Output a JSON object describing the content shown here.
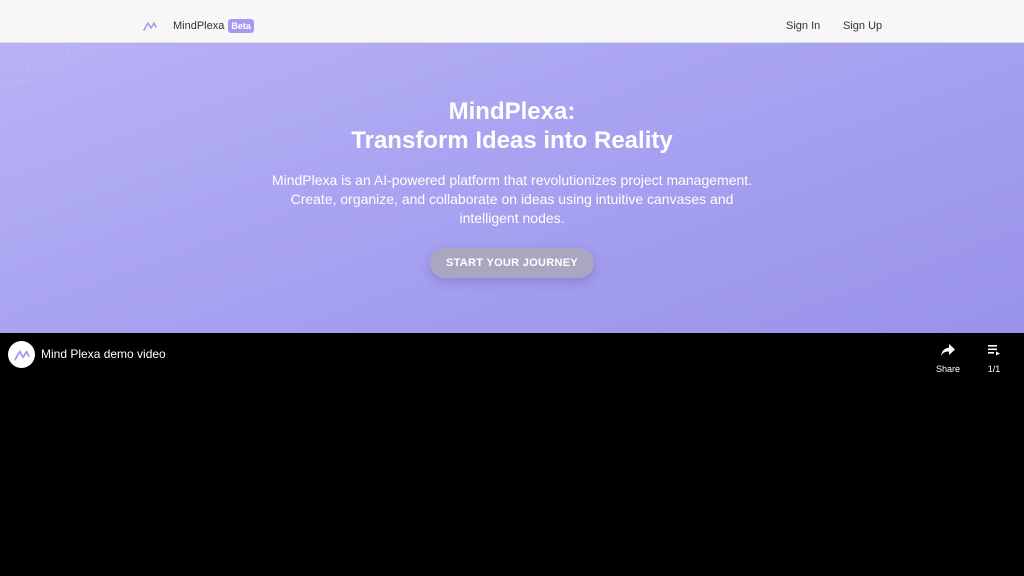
{
  "nav": {
    "brand_name": "MindPlexa",
    "beta_label": "Beta",
    "signin_label": "Sign In",
    "signup_label": "Sign Up"
  },
  "hero": {
    "title_line1": "MindPlexa:",
    "title_line2": "Transform Ideas into Reality",
    "description": "MindPlexa is an AI-powered platform that revolutionizes project management. Create, organize, and collaborate on ideas using intuitive canvases and intelligent nodes.",
    "cta_label": "START YOUR JOURNEY"
  },
  "video": {
    "title": "Mind Plexa demo video",
    "share_label": "Share",
    "playlist_label": "1/1"
  },
  "colors": {
    "accent": "#a49bf0",
    "hero_start": "#b8b3f6",
    "hero_end": "#9992ea",
    "cta_bg": "#a9a6c0"
  },
  "icons": {
    "brand": "mindplexa-logo-icon",
    "share": "share-arrow-icon",
    "playlist": "playlist-icon"
  }
}
